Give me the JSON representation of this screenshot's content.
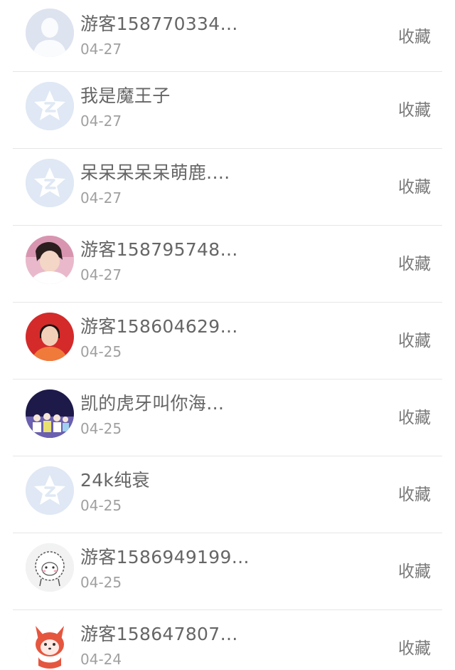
{
  "list": {
    "items": [
      {
        "name": "游客158770334…",
        "date": "04-27",
        "action": "收藏",
        "avatar": "default-person-avatar"
      },
      {
        "name": "我是魔王子",
        "date": "04-27",
        "action": "收藏",
        "avatar": "qzone-star-avatar"
      },
      {
        "name": "呆呆呆呆呆萌鹿.…",
        "date": "04-27",
        "action": "收藏",
        "avatar": "qzone-star-avatar"
      },
      {
        "name": "游客158795748…",
        "date": "04-27",
        "action": "收藏",
        "avatar": "photo-avatar-pink"
      },
      {
        "name": "游客158604629…",
        "date": "04-25",
        "action": "收藏",
        "avatar": "photo-avatar-red"
      },
      {
        "name": "凯的虎牙叫你海…",
        "date": "04-25",
        "action": "收藏",
        "avatar": "photo-avatar-group"
      },
      {
        "name": "24k纯衰",
        "date": "04-25",
        "action": "收藏",
        "avatar": "qzone-star-avatar"
      },
      {
        "name": "游客1586949199…",
        "date": "04-25",
        "action": "收藏",
        "avatar": "sheep-cartoon-avatar"
      },
      {
        "name": "游客158647807…",
        "date": "04-24",
        "action": "收藏",
        "avatar": "fox-cartoon-avatar"
      }
    ]
  },
  "colors": {
    "name_text": "#666666",
    "date_text": "#a0a0a0",
    "action_text": "#7a7a7a",
    "divider": "#e6e6e6",
    "default_avatar_bg": "#dfe7f2"
  }
}
